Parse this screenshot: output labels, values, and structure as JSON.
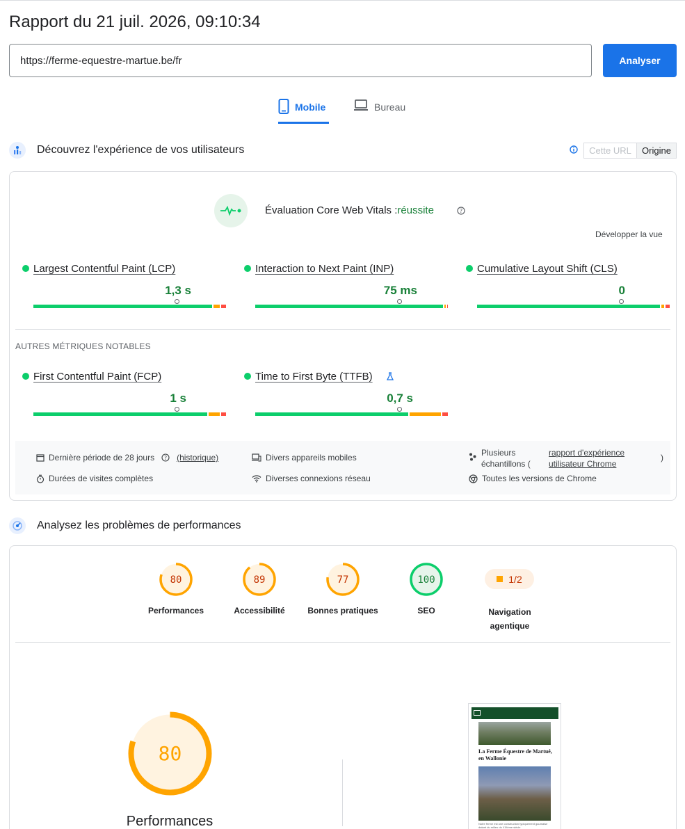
{
  "header": {
    "title": "Rapport du 21 juil. 2026, 09:10:34",
    "url_value": "https://ferme-equestre-martue.be/fr",
    "analyze_label": "Analyser"
  },
  "tabs": [
    {
      "label": "Mobile",
      "active": true
    },
    {
      "label": "Bureau",
      "active": false
    }
  ],
  "crux": {
    "section_title": "Découvrez l'expérience de vos utilisateurs",
    "toggle_url": "Cette URL",
    "toggle_origin": "Origine",
    "assessment_prefix": "Évaluation Core Web Vitals :",
    "assessment_result": "réussite",
    "expand_label": "Développer la vue",
    "core_metrics": [
      {
        "label": "Largest Contentful Paint (LCP)",
        "value": "1,3 s",
        "status_color": "#0cce6b"
      },
      {
        "label": "Interaction to Next Paint (INP)",
        "value": "75 ms",
        "status_color": "#0cce6b"
      },
      {
        "label": "Cumulative Layout Shift (CLS)",
        "value": "0",
        "status_color": "#0cce6b"
      }
    ],
    "other_title": "AUTRES MÉTRIQUES NOTABLES",
    "other_metrics": [
      {
        "label": "First Contentful Paint (FCP)",
        "value": "1 s",
        "status_color": "#0cce6b"
      },
      {
        "label": "Time to First Byte (TTFB)",
        "value": "0,7 s",
        "status_color": "#0cce6b"
      }
    ],
    "footer": {
      "period": "Dernière période de 28 jours",
      "history_link": "(historique)",
      "durations": "Durées de visites complètes",
      "devices": "Divers appareils mobiles",
      "network": "Diverses connexions réseau",
      "samples_prefix": "Plusieurs échantillons (",
      "samples_link": "rapport d'expérience utilisateur Chrome",
      "samples_suffix": ")",
      "versions": "Toutes les versions de Chrome"
    }
  },
  "lighthouse": {
    "section_title": "Analysez les problèmes de performances",
    "gauges": [
      {
        "label": "Performances",
        "score": "80",
        "score_value": 80
      },
      {
        "label": "Accessibilité",
        "score": "89",
        "score_value": 89
      },
      {
        "label": "Bonnes pratiques",
        "score": "77",
        "score_value": 77
      },
      {
        "label": "SEO",
        "score": "100",
        "score_value": 100
      }
    ],
    "agentic": {
      "label": "Navigation agentique",
      "score": "1/2"
    },
    "big_gauge": {
      "score": "80",
      "score_value": 80,
      "label": "Performances"
    },
    "screenshot_title": "La Ferme Équestre de Martué, en Wallonie",
    "screenshot_body": "Notre ferme est une construction typiquement gaumaise datant du milieu du XIXème siècle"
  },
  "colors": {
    "accent": "#1a73e8",
    "good": "#0cce6b",
    "good_text": "#188038",
    "average": "#ffa400",
    "average_text": "#c33300",
    "poor": "#ff4e42"
  }
}
